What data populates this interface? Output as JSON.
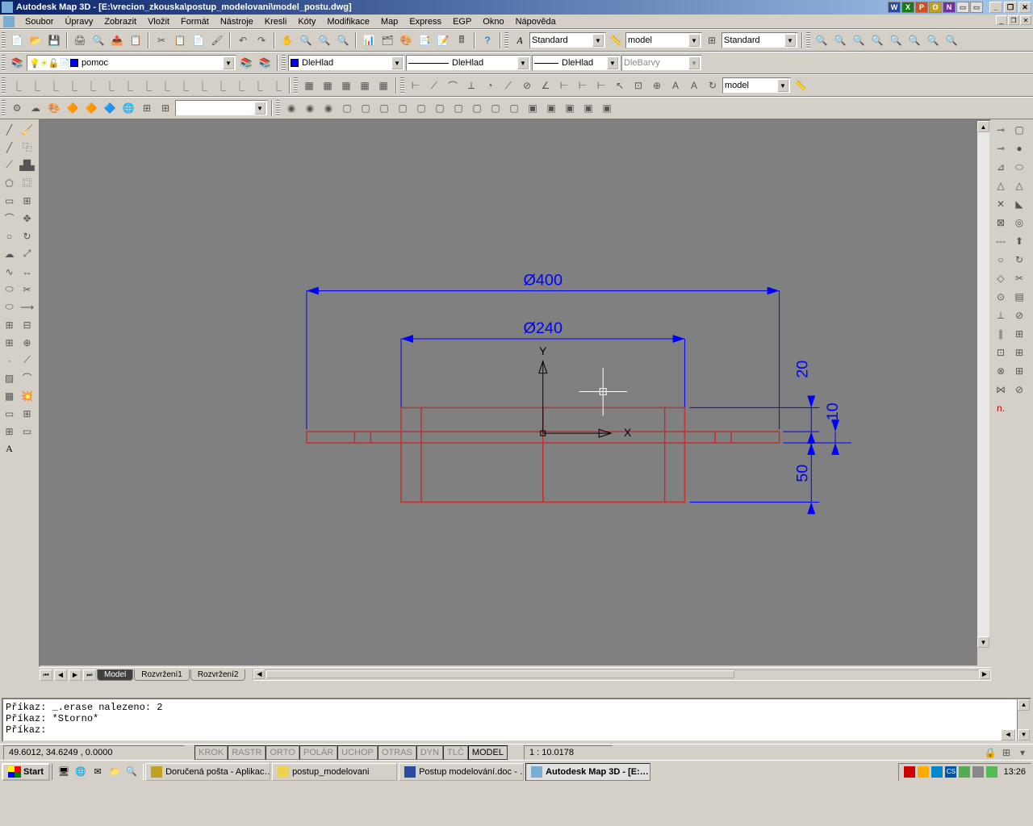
{
  "titlebar": {
    "app_title": "Autodesk Map 3D - [E:\\vrecion_zkouska\\postup_modelovani\\model_postu.dwg]",
    "tray_icons": [
      "W",
      "X",
      "P",
      "O",
      "N",
      "W2",
      "W3"
    ]
  },
  "menubar": {
    "items": [
      "Soubor",
      "Úpravy",
      "Zobrazit",
      "Vložit",
      "Formát",
      "Nástroje",
      "Kresli",
      "Kóty",
      "Modifikace",
      "Map",
      "Express",
      "EGP",
      "Okno",
      "Nápověda"
    ]
  },
  "toolbars": {
    "style1": "Standard",
    "style2": "model",
    "style3": "Standard",
    "layer_name": "pomoc",
    "linetype1": "DleHlad",
    "linetype2": "DleHlad",
    "linetype3": "DleHlad",
    "colors_label": "DleBarvy",
    "dim_model": "model",
    "blank_combo": ""
  },
  "drawing": {
    "dim_400": "Ø400",
    "dim_240": "Ø240",
    "dim_20": "20",
    "dim_10": "10",
    "dim_50": "50",
    "axis_x": "X",
    "axis_y": "Y"
  },
  "tabs": {
    "model": "Model",
    "layout1": "Rozvržení1",
    "layout2": "Rozvržení2"
  },
  "command": {
    "line1": "Příkaz: _.erase nalezeno: 2",
    "line2": "Příkaz: *Storno*",
    "line3": "Příkaz:"
  },
  "statusbar": {
    "coords": "49.6012, 34.6249 , 0.0000",
    "toggles": [
      "KROK",
      "RASTR",
      "ORTO",
      "POLÁR",
      "UCHOP",
      "OTRAS",
      "DYN",
      "TLČ",
      "MODEL"
    ],
    "scale": "1 : 10.0178"
  },
  "taskbar": {
    "start": "Start",
    "tasks": [
      "Doručená pošta - Aplikac…",
      "postup_modelovani",
      "Postup modelování.doc - …",
      "Autodesk Map 3D - [E:…"
    ],
    "lang": "CS",
    "clock": "13:26"
  }
}
